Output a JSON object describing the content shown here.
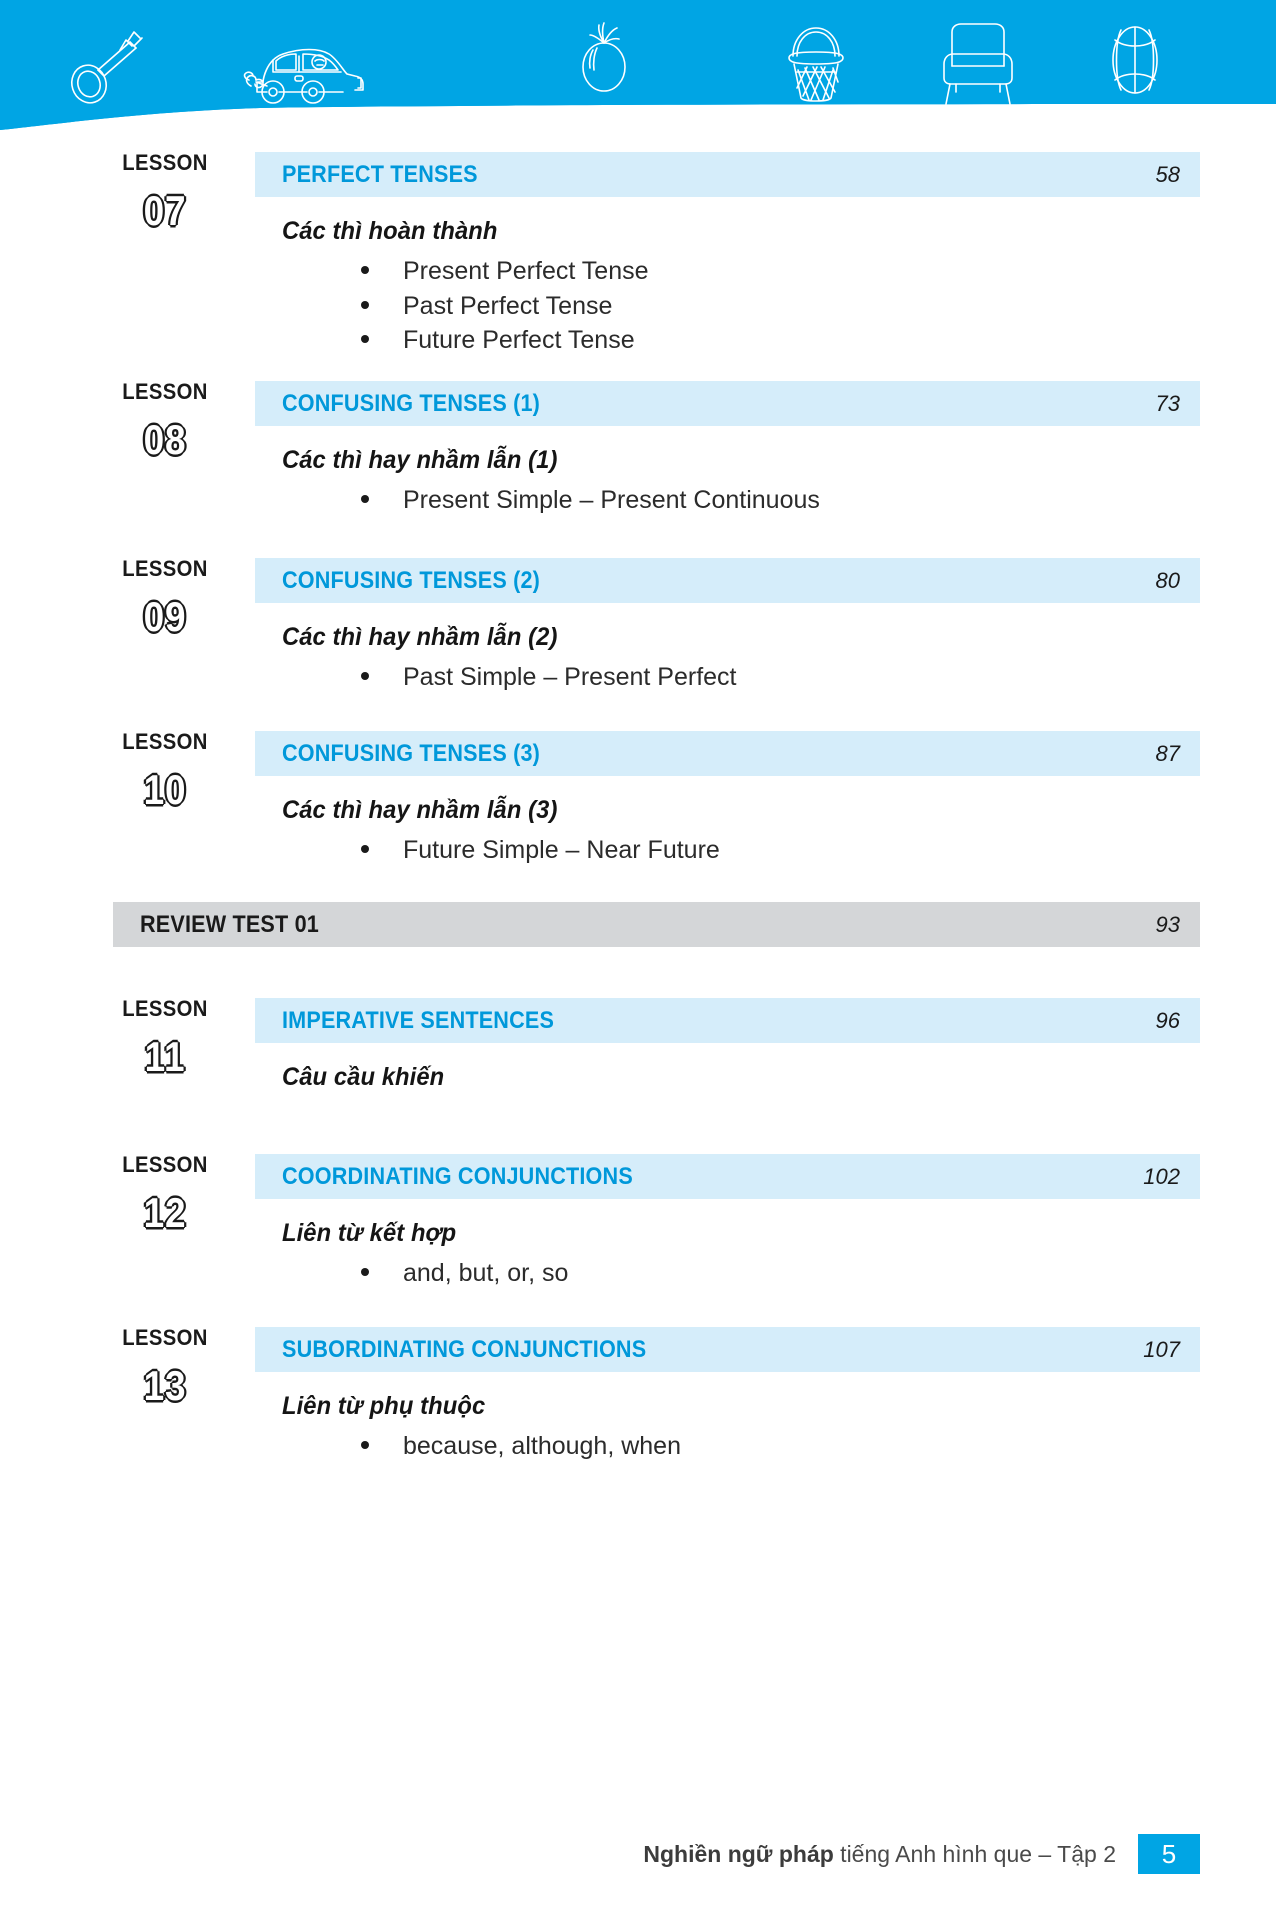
{
  "page": {
    "header_icons": [
      "key-icon",
      "car-icon",
      "tomato-icon",
      "basket-icon",
      "armchair-icon",
      "ball-icon"
    ],
    "accent_blue": "#00A5E4",
    "bar_blue": "#D5EDFA",
    "title_blue": "#0098DA",
    "review_gray": "#D4D6D8"
  },
  "lesson_label": "LESSON",
  "entries": [
    {
      "type": "lesson",
      "number": "07",
      "title": "PERFECT TENSES",
      "page": "58",
      "subtitle": "Các thì hoàn thành",
      "bullets": [
        "Present Perfect Tense",
        "Past Perfect Tense",
        "Future Perfect Tense"
      ]
    },
    {
      "type": "lesson",
      "number": "08",
      "title": "CONFUSING TENSES (1)",
      "page": "73",
      "subtitle": "Các thì hay nhầm lẫn (1)",
      "bullets": [
        "Present Simple – Present Continuous"
      ]
    },
    {
      "type": "lesson",
      "number": "09",
      "title": "CONFUSING TENSES (2)",
      "page": "80",
      "subtitle": "Các thì hay nhầm lẫn (2)",
      "bullets": [
        "Past Simple – Present Perfect"
      ]
    },
    {
      "type": "lesson",
      "number": "10",
      "title": "CONFUSING TENSES (3)",
      "page": "87",
      "subtitle": "Các thì hay nhầm lẫn (3)",
      "bullets": [
        "Future Simple – Near Future"
      ]
    },
    {
      "type": "review",
      "number": "",
      "title": "REVIEW TEST 01",
      "page": "93",
      "subtitle": "",
      "bullets": []
    },
    {
      "type": "lesson",
      "number": "11",
      "title": "IMPERATIVE SENTENCES",
      "page": "96",
      "subtitle": "Câu cầu khiến",
      "bullets": []
    },
    {
      "type": "lesson",
      "number": "12",
      "title": "COORDINATING CONJUNCTIONS",
      "page": "102",
      "subtitle": "Liên từ kết hợp",
      "bullets": [
        "and, but, or, so"
      ]
    },
    {
      "type": "lesson",
      "number": "13",
      "title": "SUBORDINATING CONJUNCTIONS",
      "page": "107",
      "subtitle": "Liên từ phụ thuộc",
      "bullets": [
        "because, although, when"
      ]
    }
  ],
  "footer": {
    "text_bold": "Nghiền ngữ pháp",
    "text_rest": " tiếng Anh hình que – Tập 2",
    "page_number": "5"
  }
}
